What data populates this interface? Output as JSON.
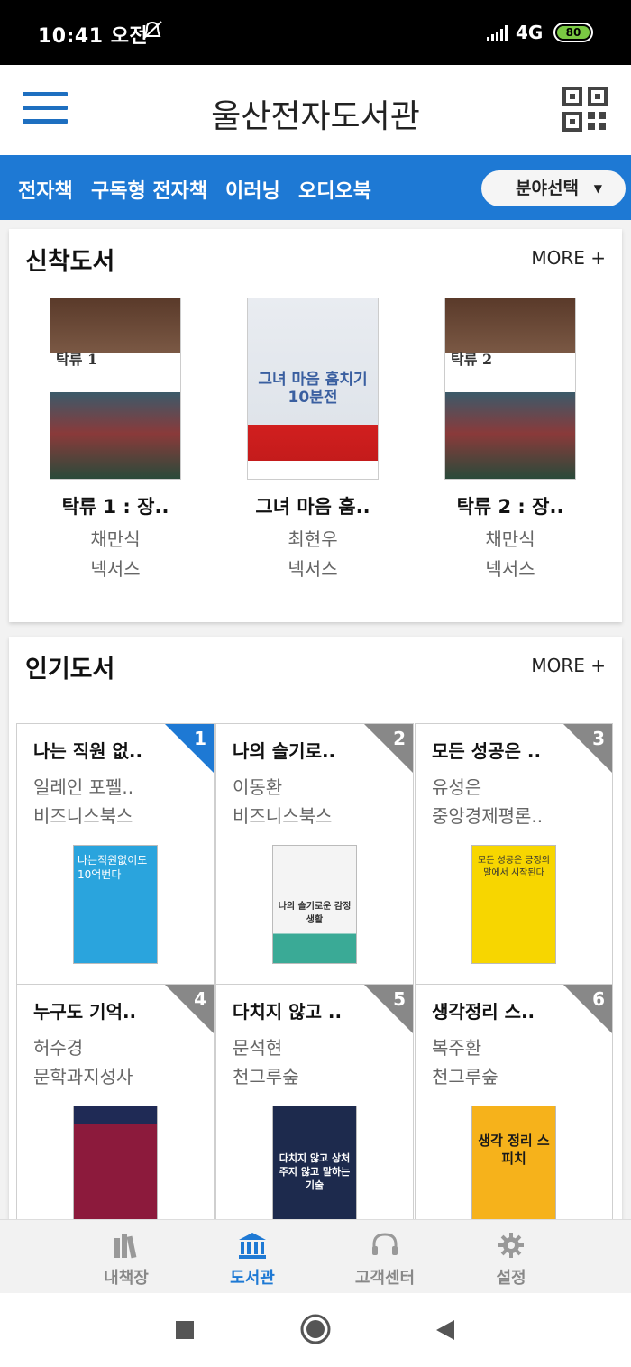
{
  "status": {
    "time": "10:41 오전",
    "network": "4G",
    "battery": "80"
  },
  "appbar": {
    "title": "울산전자도서관"
  },
  "tabs": {
    "items": [
      "전자책",
      "구독형 전자책",
      "이러닝",
      "오디오북"
    ],
    "field_select": "분야선택"
  },
  "new_books": {
    "title": "신착도서",
    "more": "MORE +",
    "items": [
      {
        "title": "탁류 1 : 장..",
        "author": "채만식",
        "publisher": "넥서스",
        "cover_text": "탁류 1"
      },
      {
        "title": "그녀 마음 훔..",
        "author": "최현우",
        "publisher": "넥서스",
        "cover_text": "그녀 마음 훔치기 10분전"
      },
      {
        "title": "탁류 2 : 장..",
        "author": "채만식",
        "publisher": "넥서스",
        "cover_text": "탁류 2"
      }
    ]
  },
  "popular_books": {
    "title": "인기도서",
    "more": "MORE +",
    "items": [
      {
        "rank": "1",
        "title": "나는 직원 없..",
        "author": "일레인 포펠..",
        "publisher": "비즈니스북스",
        "cover_text": "나는직원없이도 10억번다",
        "cover_color": "#2aa4dd"
      },
      {
        "rank": "2",
        "title": "나의 슬기로..",
        "author": "이동환",
        "publisher": "비즈니스북스",
        "cover_text": "나의 슬기로운 감정생활",
        "cover_color": "#f4f4f4"
      },
      {
        "rank": "3",
        "title": "모든 성공은 ..",
        "author": "유성은",
        "publisher": "중앙경제평론..",
        "cover_text": "모든 성공은 긍정의 말에서 시작된다",
        "cover_color": "#f7d600"
      },
      {
        "rank": "4",
        "title": "누구도 기억..",
        "author": "허수경",
        "publisher": "문학과지성사",
        "cover_text": "",
        "cover_color": "#8c1a3c"
      },
      {
        "rank": "5",
        "title": "다치지 않고 ..",
        "author": "문석현",
        "publisher": "천그루숲",
        "cover_text": "다치지 않고 상처주지 않고 말하는 기술",
        "cover_color": "#1d2a4d"
      },
      {
        "rank": "6",
        "title": "생각정리 스..",
        "author": "복주환",
        "publisher": "천그루숲",
        "cover_text": "생각 정리 스피치",
        "cover_color": "#f6b21b"
      }
    ]
  },
  "bottom_nav": {
    "items": [
      "내책장",
      "도서관",
      "고객센터",
      "설정"
    ],
    "active": "도서관"
  }
}
